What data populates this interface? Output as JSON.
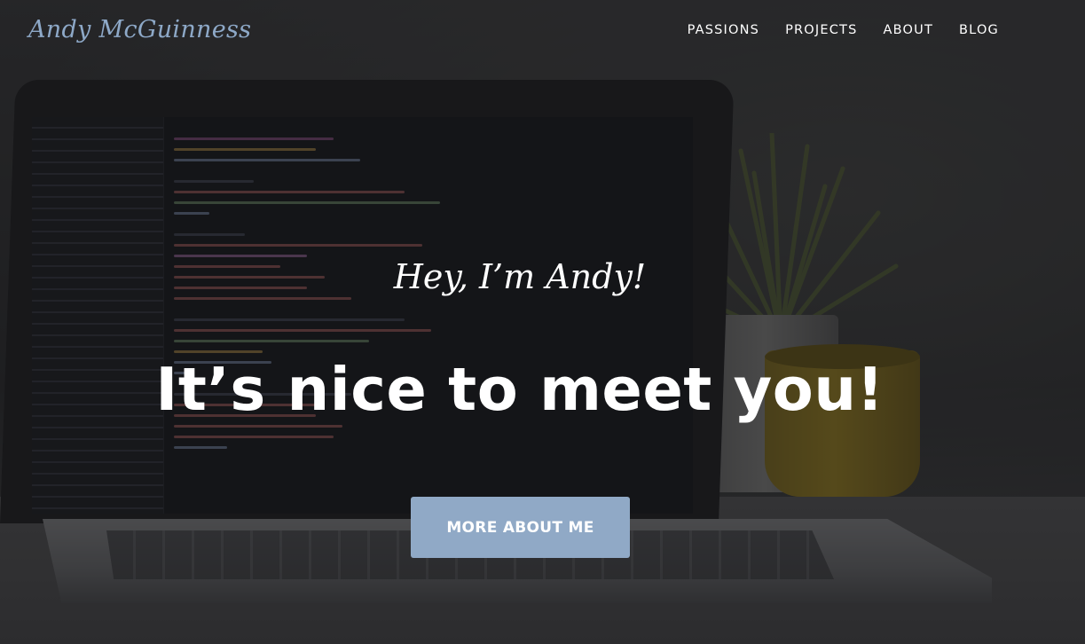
{
  "header": {
    "logo_text": "Andy McGuinness",
    "nav": [
      {
        "label": "PASSIONS"
      },
      {
        "label": "PROJECTS"
      },
      {
        "label": "ABOUT"
      },
      {
        "label": "BLOG"
      }
    ]
  },
  "hero": {
    "greeting": "Hey, I’m Andy!",
    "headline": "It’s nice to meet you!",
    "cta_label": "MORE ABOUT ME",
    "background_image": "laptop-on-desk-with-code-editor-photo"
  },
  "colors": {
    "accent": "#90a9c6",
    "logo": "#8ea9c8",
    "text": "#ffffff",
    "overlay": "#141416"
  }
}
